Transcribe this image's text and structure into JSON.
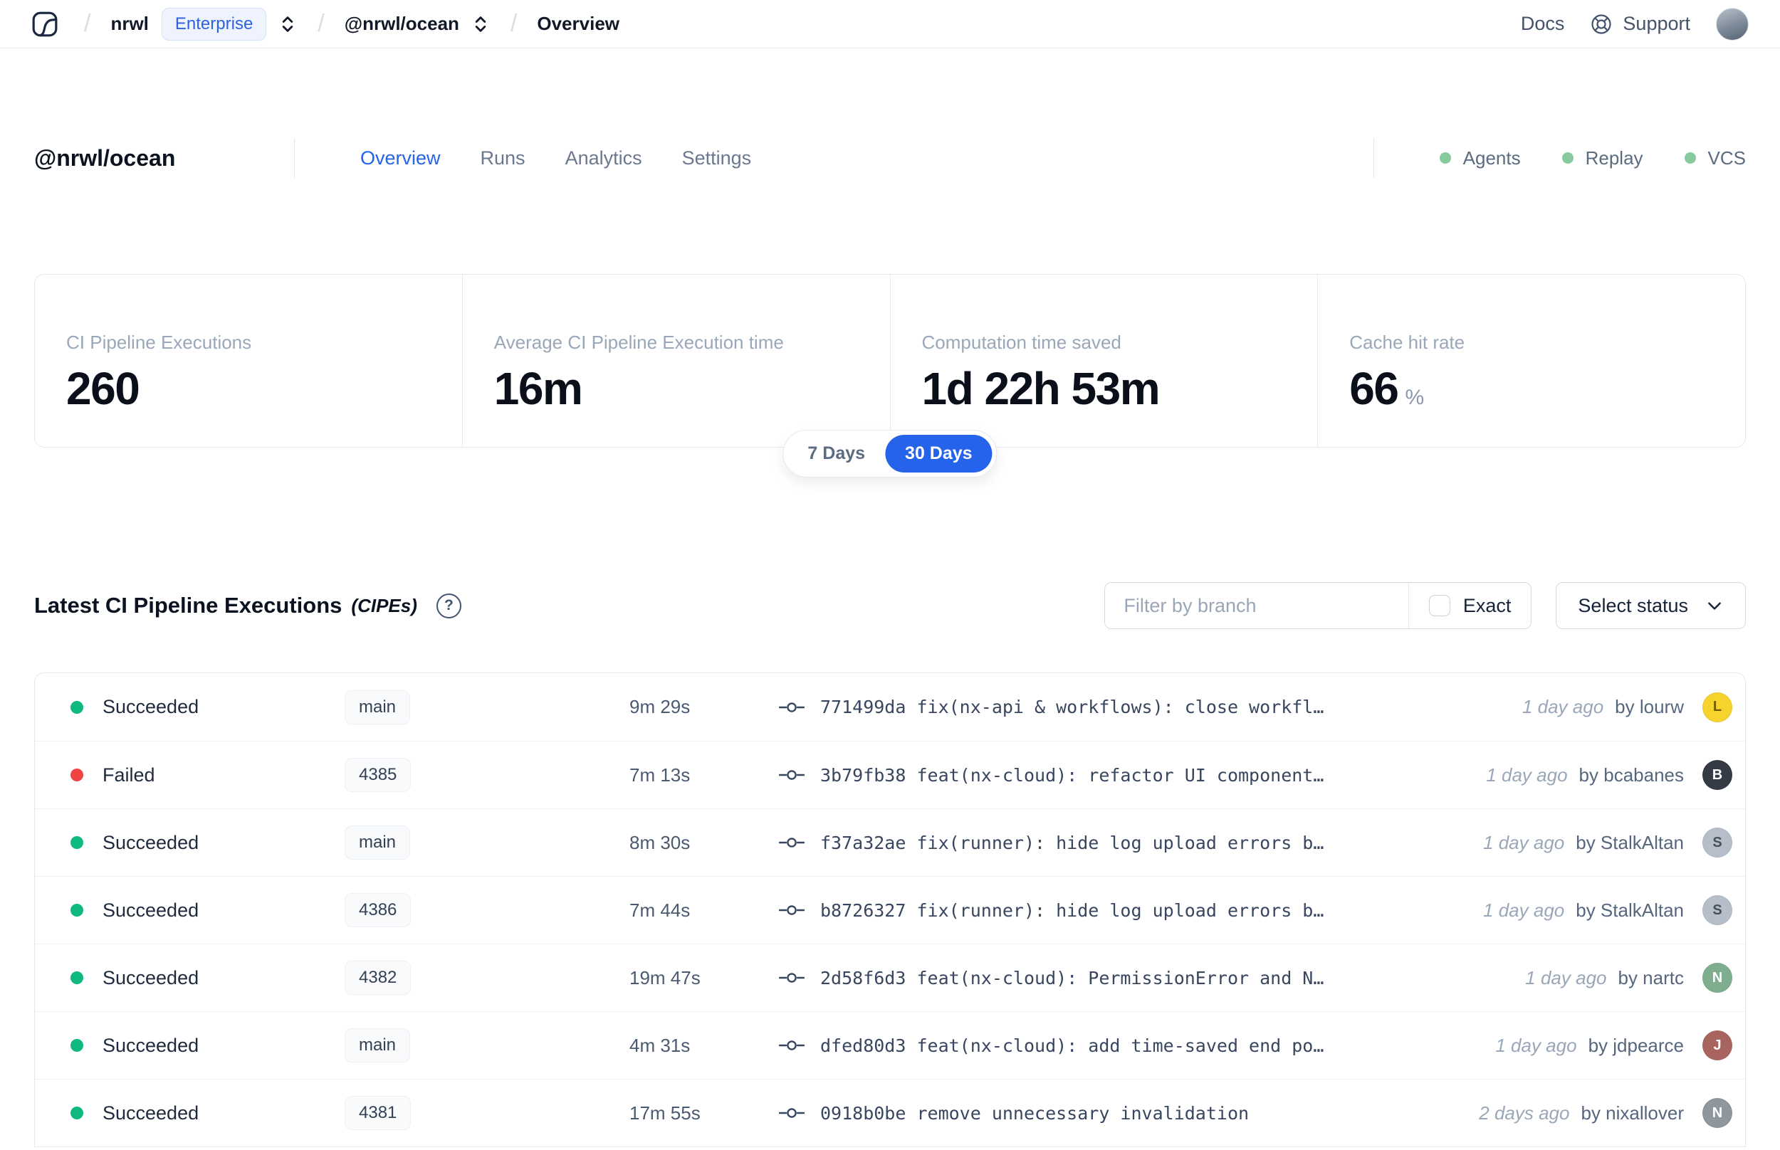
{
  "navbar": {
    "breadcrumb": {
      "org": "nrwl",
      "org_badge": "Enterprise",
      "workspace": "@nrwl/ocean",
      "page": "Overview"
    },
    "links": {
      "docs": "Docs",
      "support": "Support"
    }
  },
  "header": {
    "title": "@nrwl/ocean",
    "tabs": [
      {
        "label": "Overview",
        "active": true
      },
      {
        "label": "Runs",
        "active": false
      },
      {
        "label": "Analytics",
        "active": false
      },
      {
        "label": "Settings",
        "active": false
      }
    ],
    "services": [
      {
        "label": "Agents"
      },
      {
        "label": "Replay"
      },
      {
        "label": "VCS"
      }
    ],
    "service_dot_color": "#86ca9d"
  },
  "stats": [
    {
      "label": "CI Pipeline Executions",
      "value": "260",
      "suffix": ""
    },
    {
      "label": "Average CI Pipeline Execution time",
      "value": "16m",
      "suffix": ""
    },
    {
      "label": "Computation time saved",
      "value": "1d 22h 53m",
      "suffix": ""
    },
    {
      "label": "Cache hit rate",
      "value": "66",
      "suffix": "%"
    }
  ],
  "range_toggle": {
    "options": [
      "7 Days",
      "30 Days"
    ],
    "selected": "30 Days",
    "active_color": "#2563eb"
  },
  "section": {
    "title": "Latest CI Pipeline Executions",
    "title_suffix": "(CIPEs)",
    "filter_placeholder": "Filter by branch",
    "exact_label": "Exact",
    "status_dropdown": "Select status"
  },
  "table": {
    "by_label": "by",
    "rows": [
      {
        "status": "Succeeded",
        "status_color": "#10b981",
        "branch": "main",
        "duration": "9m 29s",
        "commit": "771499da fix(nx-api & workflows): close workfl…",
        "time": "1 day ago",
        "author": "lourw",
        "avatar_color": "#f6d32d",
        "avatar_fg": "#6b5b00"
      },
      {
        "status": "Failed",
        "status_color": "#ef4444",
        "branch": "4385",
        "duration": "7m 13s",
        "commit": "3b79fb38 feat(nx-cloud): refactor UI component…",
        "time": "1 day ago",
        "author": "bcabanes",
        "avatar_color": "#353b45",
        "avatar_fg": "#ffffff"
      },
      {
        "status": "Succeeded",
        "status_color": "#10b981",
        "branch": "main",
        "duration": "8m 30s",
        "commit": "f37a32ae fix(runner): hide log upload errors b…",
        "time": "1 day ago",
        "author": "StalkAltan",
        "avatar_color": "#b6bfc9",
        "avatar_fg": "#45505c"
      },
      {
        "status": "Succeeded",
        "status_color": "#10b981",
        "branch": "4386",
        "duration": "7m 44s",
        "commit": "b8726327 fix(runner): hide log upload errors b…",
        "time": "1 day ago",
        "author": "StalkAltan",
        "avatar_color": "#b6bfc9",
        "avatar_fg": "#45505c"
      },
      {
        "status": "Succeeded",
        "status_color": "#10b981",
        "branch": "4382",
        "duration": "19m 47s",
        "commit": "2d58f6d3 feat(nx-cloud): PermissionError and N…",
        "time": "1 day ago",
        "author": "nartc",
        "avatar_color": "#7fae8e",
        "avatar_fg": "#ffffff"
      },
      {
        "status": "Succeeded",
        "status_color": "#10b981",
        "branch": "main",
        "duration": "4m 31s",
        "commit": "dfed80d3 feat(nx-cloud): add time-saved end po…",
        "time": "1 day ago",
        "author": "jdpearce",
        "avatar_color": "#a8655f",
        "avatar_fg": "#ffffff"
      },
      {
        "status": "Succeeded",
        "status_color": "#10b981",
        "branch": "4381",
        "duration": "17m 55s",
        "commit": "0918b0be remove unnecessary invalidation",
        "time": "2 days ago",
        "author": "nixallover",
        "avatar_color": "#8f969e",
        "avatar_fg": "#ffffff"
      }
    ]
  }
}
